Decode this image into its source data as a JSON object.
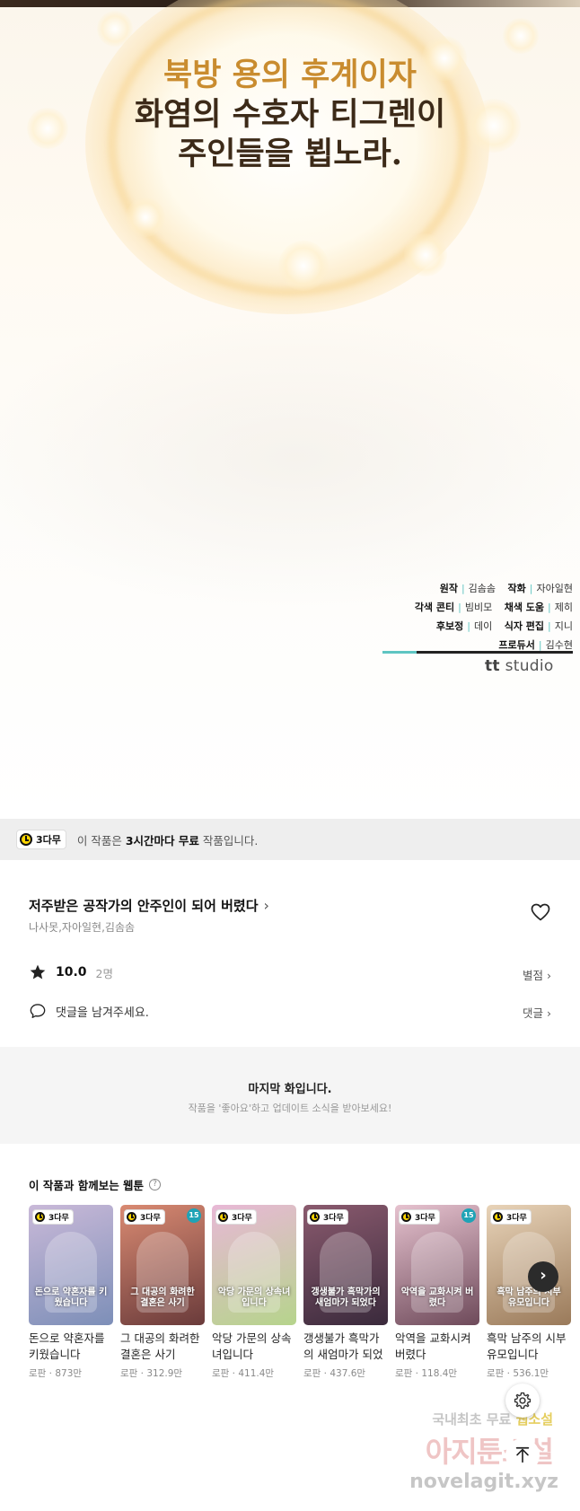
{
  "comic": {
    "lines": [
      "북방 용의 후계이자",
      "화염의 수호자 티그렌이",
      "주인들을 뵙노라."
    ],
    "credits": [
      [
        {
          "role": "원작",
          "name": "김솜솜"
        },
        {
          "role": "작화",
          "name": "자아일현"
        }
      ],
      [
        {
          "role": "각색 콘티",
          "name": "빔비모"
        },
        {
          "role": "채색 도움",
          "name": "제히"
        }
      ],
      [
        {
          "role": "후보정",
          "name": "데이"
        },
        {
          "role": "식자 편집",
          "name": "지니"
        }
      ],
      [
        {
          "role": "프로듀서",
          "name": "김수현"
        }
      ]
    ],
    "studio_mark": "tt",
    "studio_name": "studio"
  },
  "notice": {
    "badge": "3다무",
    "prefix": "이 작품은 ",
    "bold": "3시간마다 무료",
    "suffix": " 작품입니다."
  },
  "work": {
    "title": "저주받은 공작가의 안주인이 되어 버렸다",
    "authors": "나사못,자아일현,김솜솜",
    "rating": "10.0",
    "rating_count": "2명",
    "rating_link": "별점",
    "comment_prompt": "댓글을 남겨주세요.",
    "comment_link": "댓글"
  },
  "last_episode": {
    "title": "마지막 화입니다.",
    "subtitle": "작품을 '좋아요'하고 업데이트 소식을 받아보세요!"
  },
  "recommend": {
    "title": "이 작품과 함께보는 웹툰",
    "badge": "3다무",
    "age_badge": "15",
    "items": [
      {
        "title": "돈으로 약혼자를 키웠습니다",
        "genre": "로판",
        "views": "873만",
        "cover": "돈으로 약혼자를 키웠습니다",
        "age": false,
        "c1": "#c9b9d8",
        "c2": "#7d8fb8"
      },
      {
        "title": "그 대공의 화려한 결혼은 사기",
        "genre": "로판",
        "views": "312.9만",
        "cover": "그 대공의 화려한 결혼은 사기",
        "age": true,
        "c1": "#d98a72",
        "c2": "#6a3b3b"
      },
      {
        "title": "악당 가문의 상속녀입니다",
        "genre": "로판",
        "views": "411.4만",
        "cover": "악당 가문의 상속녀입니다",
        "age": false,
        "c1": "#e8b8d6",
        "c2": "#b6d48c"
      },
      {
        "title": "갱생불가 흑막가의 새엄마가 되었다",
        "genre": "로판",
        "views": "437.6만",
        "cover": "갱생불가 흑막가의 새엄마가 되었다",
        "age": false,
        "c1": "#8a5a6e",
        "c2": "#3a2a3c"
      },
      {
        "title": "악역을 교화시켜 버렸다",
        "genre": "로판",
        "views": "118.4만",
        "cover": "악역을 교화시켜 버렸다",
        "age": true,
        "c1": "#e6c2cf",
        "c2": "#6e4a5a"
      },
      {
        "title": "흑막 남주의 시부 유모입니다",
        "genre": "로판",
        "views": "536.1만",
        "cover": "흑막 남주의 시부 유모입니다",
        "age": false,
        "c1": "#e8d3b8",
        "c2": "#9a7a5a"
      }
    ]
  },
  "watermark": {
    "line1_a": "국내최초 무료",
    "line1_b": "웹소설",
    "line2": "아지툰소설",
    "line3": "novelagit.xyz"
  },
  "icons": {
    "heart": "heart-icon",
    "star": "star-icon",
    "comment": "comment-icon",
    "settings": "gear-icon",
    "top": "arrow-up-icon",
    "next": "chevron-right-icon"
  },
  "colors": {
    "accent_teal": "#5ec5c2",
    "badge_yellow": "#ffd600",
    "age_badge": "#1fa3b6",
    "comic_gold": "#c98c2f"
  }
}
